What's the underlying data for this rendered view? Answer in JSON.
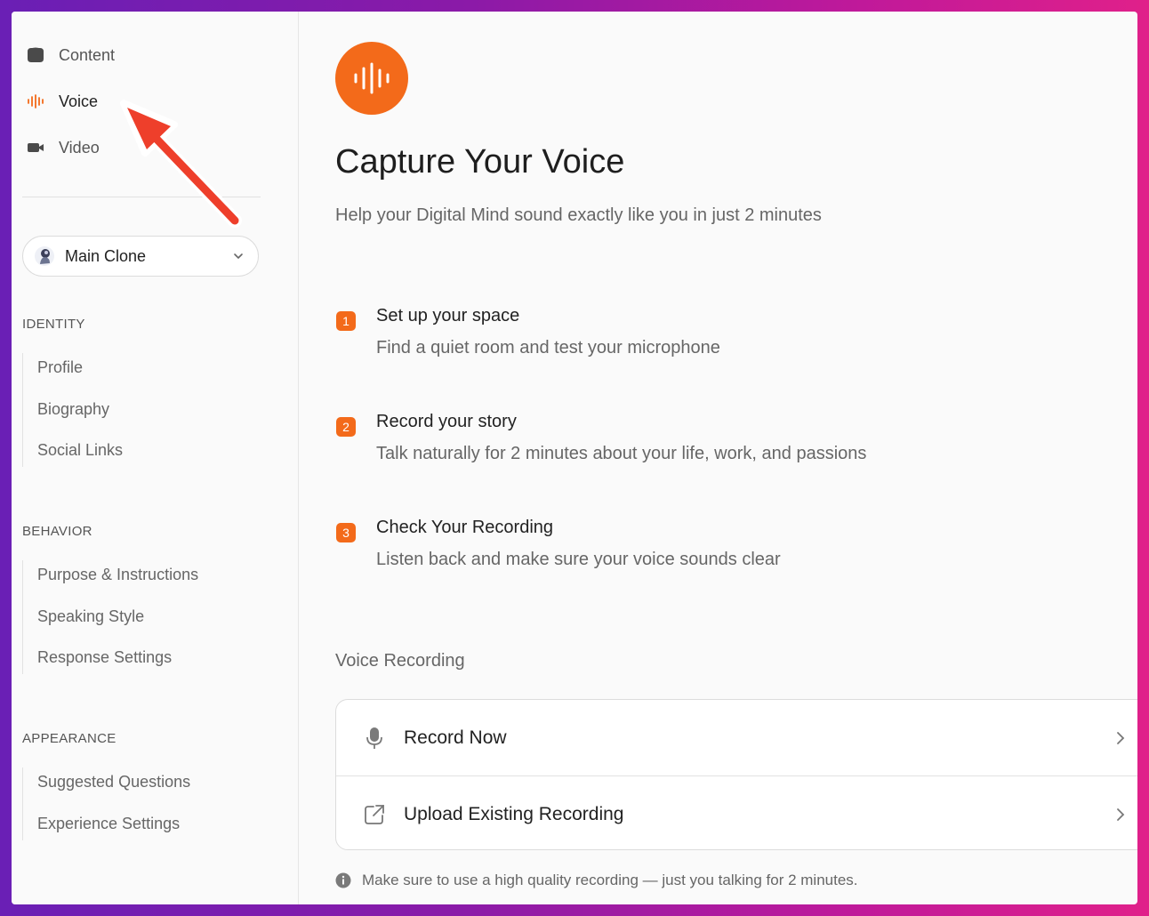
{
  "colors": {
    "accent": "#f36a1a",
    "annotation_arrow": "#ee3f2b"
  },
  "nav": [
    {
      "label": "Content",
      "icon": "content-icon"
    },
    {
      "label": "Voice",
      "icon": "waveform-icon",
      "active": true
    },
    {
      "label": "Video",
      "icon": "video-camera-icon"
    }
  ],
  "clone_selector": {
    "label": "Main Clone",
    "icon": "avatar"
  },
  "sections": {
    "identity": {
      "title": "IDENTITY",
      "items": [
        "Profile",
        "Biography",
        "Social Links"
      ]
    },
    "behavior": {
      "title": "BEHAVIOR",
      "items": [
        "Purpose & Instructions",
        "Speaking Style",
        "Response Settings"
      ]
    },
    "appearance": {
      "title": "APPEARANCE",
      "items": [
        "Suggested Questions",
        "Experience Settings"
      ]
    }
  },
  "main": {
    "title": "Capture Your Voice",
    "subtitle": "Help your Digital Mind sound exactly like you in just 2 minutes",
    "steps": [
      {
        "num": "1",
        "title": "Set up your space",
        "desc": "Find a quiet room and test your microphone"
      },
      {
        "num": "2",
        "title": "Record your story",
        "desc": "Talk naturally for 2 minutes about your life, work, and passions"
      },
      {
        "num": "3",
        "title": "Check Your Recording",
        "desc": "Listen back and make sure your voice sounds clear"
      }
    ],
    "recording": {
      "heading": "Voice Recording",
      "options": [
        {
          "label": "Record Now",
          "icon": "microphone-icon"
        },
        {
          "label": "Upload Existing Recording",
          "icon": "external-link-icon"
        }
      ],
      "note": "Make sure to use a high quality recording — just you talking for 2 minutes."
    }
  }
}
